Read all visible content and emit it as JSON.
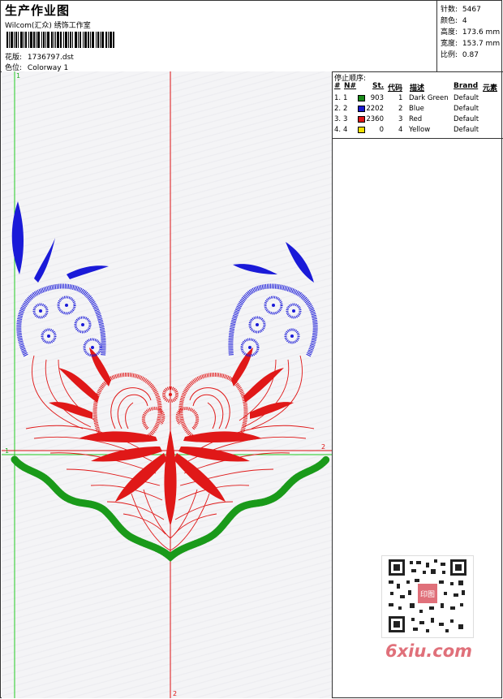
{
  "header": {
    "title": "生产作业图",
    "company": "Wilcom(汇众) 绣饰工作室",
    "design_label": "花版:",
    "design_file": "1736797.dst",
    "colorway_label": "色位:",
    "colorway": "Colorway 1"
  },
  "stats": [
    {
      "label": "针数:",
      "value": "5467"
    },
    {
      "label": "颜色:",
      "value": "4"
    },
    {
      "label": "高度:",
      "value": "173.6 mm"
    },
    {
      "label": "宽度:",
      "value": "153.7 mm"
    },
    {
      "label": "比例:",
      "value": "0.87"
    }
  ],
  "stop_sequence": {
    "title": "停止顺序:",
    "columns": [
      "#",
      "N#",
      "St.",
      "代码",
      "描述",
      "Brand",
      "元素"
    ],
    "rows": [
      {
        "num": "1.",
        "n": "1",
        "color": "#1a8a1a",
        "st": "903",
        "code": "1",
        "desc": "Dark Green",
        "brand": "Default"
      },
      {
        "num": "2.",
        "n": "2",
        "color": "#1a1ad0",
        "st": "2202",
        "code": "2",
        "desc": "Blue",
        "brand": "Default"
      },
      {
        "num": "3.",
        "n": "3",
        "color": "#e01818",
        "st": "2360",
        "code": "3",
        "desc": "Red",
        "brand": "Default"
      },
      {
        "num": "4.",
        "n": "4",
        "color": "#f0e000",
        "st": "0",
        "code": "4",
        "desc": "Yellow",
        "brand": "Default"
      }
    ]
  },
  "canvas": {
    "guide_labels": {
      "v_top": "1",
      "h_left": "1",
      "h_right": "2",
      "v_bottom": "2"
    },
    "colors": {
      "green": "#1a9a1a",
      "blue": "#1a1ad8",
      "red": "#e01818",
      "guide_green": "#22cc22",
      "guide_red": "#dd1111"
    }
  },
  "watermark": {
    "text": "6xiu.com",
    "seal_text": "印图"
  }
}
